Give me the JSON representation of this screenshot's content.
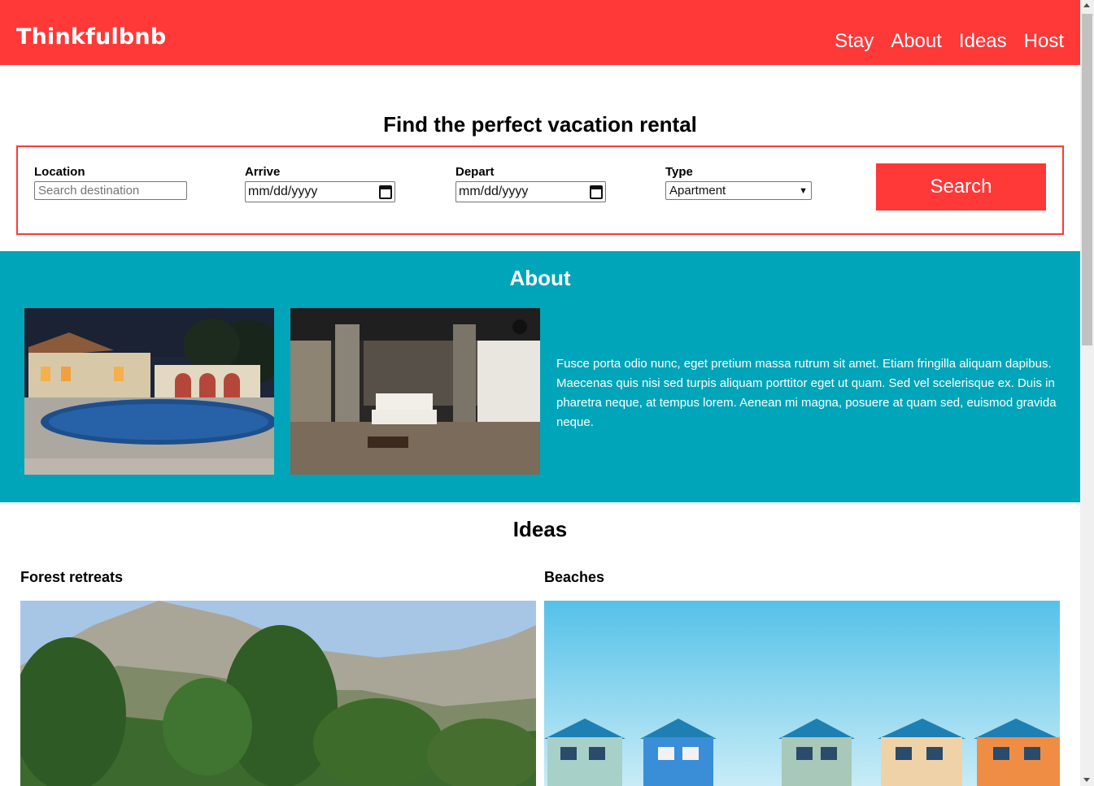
{
  "header": {
    "logo": "Thinkfulbnb",
    "nav": [
      "Stay",
      "About",
      "Ideas",
      "Host"
    ]
  },
  "search": {
    "title": "Find the perfect vacation rental",
    "location_label": "Location",
    "location_placeholder": "Search destination",
    "arrive_label": "Arrive",
    "arrive_value": "mm/dd/yyyy",
    "depart_label": "Depart",
    "depart_value": "mm/dd/yyyy",
    "type_label": "Type",
    "type_value": "Apartment",
    "button": "Search"
  },
  "about": {
    "title": "About",
    "text": "Fusce porta odio nunc, eget pretium massa rutrum sit amet. Etiam fringilla aliquam dapibus. Maecenas quis nisi sed turpis aliquam porttitor eget ut quam. Sed vel scelerisque ex. Duis in pharetra neque, at tempus lorem. Aenean mi magna, posuere at quam sed, euismod gravida neque."
  },
  "ideas": {
    "title": "Ideas",
    "items": [
      "Forest retreats",
      "Beaches"
    ]
  },
  "colors": {
    "brand": "#ff3838",
    "about_bg": "#00a5b9"
  }
}
